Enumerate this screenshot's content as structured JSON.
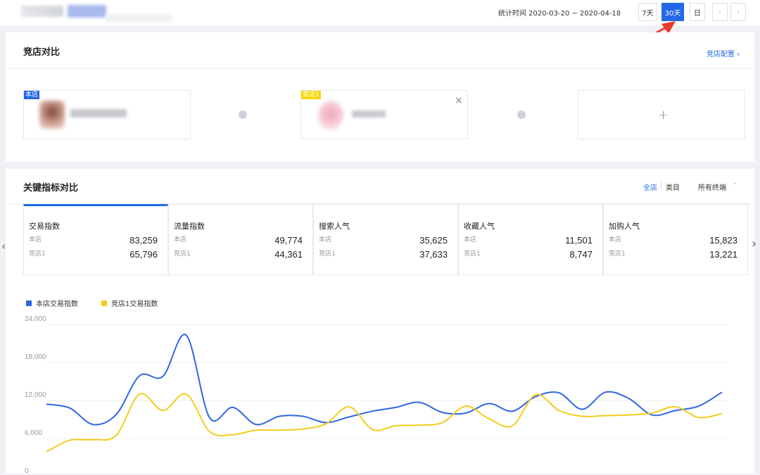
{
  "topbar": {
    "stat_time_label": "统计时间 2020-03-20 ~ 2020-04-18",
    "range_7": "7天",
    "range_30": "30天",
    "range_day": "日",
    "prev": "‹",
    "next": "›"
  },
  "compare_section": {
    "title": "竞店对比",
    "config_link": "竞店配置 ›",
    "own_tag": "本店",
    "comp_tag": "竞店1",
    "close": "×",
    "add": "+"
  },
  "metrics_section": {
    "title": "关键指标对比",
    "filter_all": "全店",
    "filter_sep": "|",
    "filter_category": "类目",
    "filter_terminal": "所有终端",
    "filter_chevron": "⌄",
    "left_arrow": "‹",
    "right_arrow": "›",
    "cards": [
      {
        "name": "交易指数",
        "own_label": "本店",
        "own_value": "83,259",
        "comp_label": "竞店1",
        "comp_value": "65,796"
      },
      {
        "name": "流量指数",
        "own_label": "本店",
        "own_value": "49,774",
        "comp_label": "竞店1",
        "comp_value": "44,361"
      },
      {
        "name": "搜索人气",
        "own_label": "本店",
        "own_value": "35,625",
        "comp_label": "竞店1",
        "comp_value": "37,633"
      },
      {
        "name": "收藏人气",
        "own_label": "本店",
        "own_value": "11,501",
        "comp_label": "竞店1",
        "comp_value": "8,747"
      },
      {
        "name": "加购人气",
        "own_label": "本店",
        "own_value": "15,823",
        "comp_label": "竞店1",
        "comp_value": "13,221"
      }
    ]
  },
  "chart_data": {
    "type": "line",
    "title": "",
    "xlabel": "",
    "ylabel": "",
    "ylim": [
      0,
      24000
    ],
    "yticks": [
      "24,000",
      "18,000",
      "12,000",
      "6,000",
      "0"
    ],
    "grid": true,
    "legend_position": "top-left",
    "series": [
      {
        "name": "本店交易指数",
        "color": "#2f67e0",
        "values": [
          11400,
          10800,
          8200,
          9800,
          15900,
          15800,
          22300,
          9300,
          10900,
          8200,
          9500,
          9500,
          8500,
          9400,
          10300,
          10900,
          11700,
          10100,
          10000,
          11500,
          10300,
          12600,
          13200,
          10600,
          13300,
          12300,
          9700,
          10400,
          11100,
          13300
        ]
      },
      {
        "name": "竞店1交易指数",
        "color": "#f2cc1f",
        "values": [
          3900,
          5700,
          5800,
          6500,
          13000,
          10400,
          13000,
          7100,
          6600,
          7300,
          7300,
          7500,
          8300,
          11000,
          7400,
          8000,
          8100,
          8500,
          11100,
          9100,
          8000,
          12900,
          10400,
          9500,
          9600,
          9700,
          10000,
          11000,
          9300,
          9900
        ]
      }
    ],
    "colors": {
      "accent": "#2468e8",
      "own": "#2f67e0",
      "competitor": "#f2cc1f",
      "arrow": "#e83a2e"
    }
  }
}
